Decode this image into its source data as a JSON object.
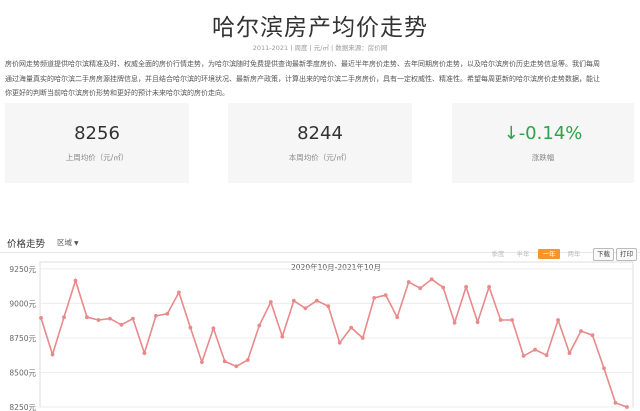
{
  "header": {
    "title": "哈尔滨房产均价走势",
    "subtitle": "2011-2021 | 周度 | 元/㎡ | 数据来源：房价网"
  },
  "description": [
    "房价网走势频道提供哈尔滨精准及时、权威全面的房价行情走势，为哈尔滨随时免费提供查询最新季度房价、最近半年房价走势、去年同期房价走势，以及哈尔滨房价历史走势信息等。我们每周",
    "通过海量真实的哈尔滨二手房房源挂牌信息，并且结合哈尔滨的环境状况、最新房产政策，计算出来的哈尔滨二手房房价，具有一定权威性、精准性。希望每周更新的哈尔滨房价走势数据，能让",
    "你更好的判断当前哈尔滨房价形势和更好的预计未来哈尔滨的房价走向。"
  ],
  "stats": [
    {
      "value": "8256",
      "label": "上周均价（元/㎡）"
    },
    {
      "value": "8244",
      "label": "本周均价（元/㎡）"
    },
    {
      "value": "↓-0.14%",
      "label": "涨跌幅"
    }
  ],
  "chart_section": {
    "title": "价格走势",
    "region_label": "区域",
    "ranges": [
      "季度",
      "半年",
      "一年",
      "两年"
    ],
    "active_range": "一年",
    "download_label": "下载",
    "print_label": "打印"
  },
  "colors": {
    "line": "#e8898a",
    "accent": "#f7942a",
    "down": "#2fa24a"
  },
  "chart_data": {
    "type": "line",
    "title": "2020年10月-2021年10月",
    "ylim": [
      8250,
      9300
    ],
    "yticks": [
      "9250元",
      "9000元",
      "8750元",
      "8500元",
      "8250元"
    ],
    "ytick_values": [
      9250,
      9000,
      8750,
      8500,
      8250
    ],
    "grid": true,
    "series": [
      {
        "values": [
          8895,
          8630,
          8900,
          9165,
          8900,
          8880,
          8890,
          8845,
          8890,
          8640,
          8910,
          8925,
          9080,
          8825,
          8575,
          8820,
          8580,
          8545,
          8590,
          8840,
          9010,
          8760,
          9020,
          8965,
          9020,
          8980,
          8715,
          8825,
          8750,
          9040,
          9060,
          8900,
          9155,
          9110,
          9175,
          9115,
          8860,
          9120,
          8865,
          9120,
          8880,
          8880,
          8620,
          8665,
          8625,
          8880,
          8640,
          8800,
          8770,
          8530,
          8280,
          8250
        ]
      }
    ]
  }
}
